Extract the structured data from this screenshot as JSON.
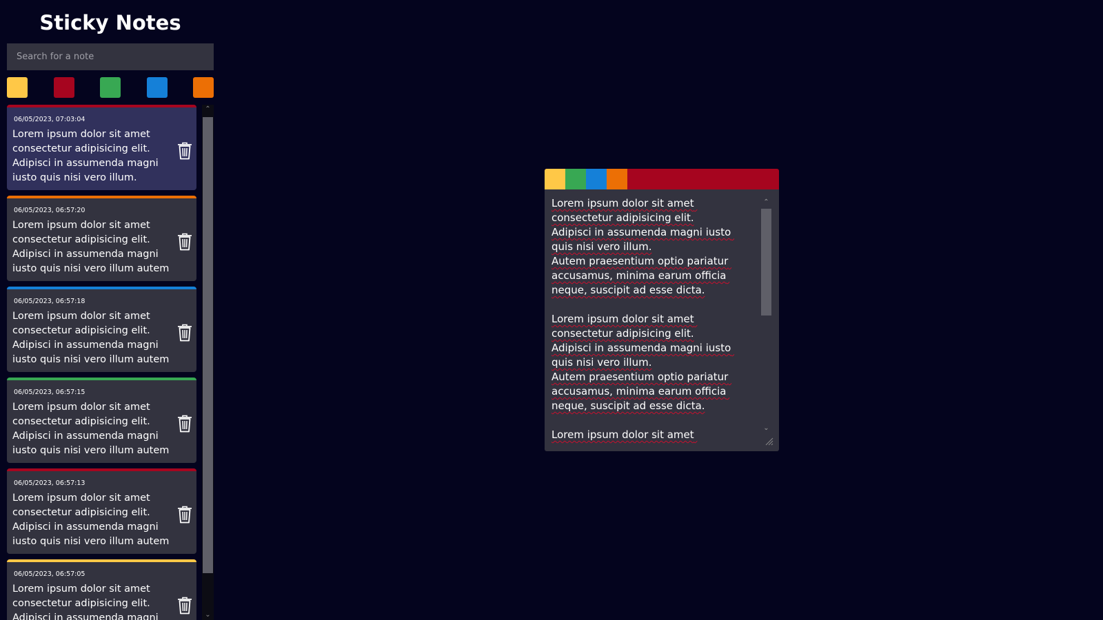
{
  "app": {
    "title": "Sticky Notes"
  },
  "search": {
    "placeholder": "Search for a note"
  },
  "colors": {
    "yellow": "#ffc847",
    "red": "#a6051f",
    "green": "#38a853",
    "blue": "#1580d8",
    "orange": "#ec6f05"
  },
  "palette": [
    "yellow",
    "red",
    "green",
    "blue",
    "orange"
  ],
  "notes": [
    {
      "date": "06/05/2023, 07:03:04",
      "color": "red",
      "active": true,
      "text": "Lorem ipsum dolor sit amet consectetur adipisicing elit. Adipisci in assumenda magni iusto quis nisi vero illum. Autem"
    },
    {
      "date": "06/05/2023, 06:57:20",
      "color": "orange",
      "active": false,
      "text": "Lorem ipsum dolor sit amet consectetur adipisicing elit. Adipisci in assumenda magni iusto quis nisi vero illum autem"
    },
    {
      "date": "06/05/2023, 06:57:18",
      "color": "blue",
      "active": false,
      "text": "Lorem ipsum dolor sit amet consectetur adipisicing elit. Adipisci in assumenda magni iusto quis nisi vero illum autem"
    },
    {
      "date": "06/05/2023, 06:57:15",
      "color": "green",
      "active": false,
      "text": "Lorem ipsum dolor sit amet consectetur adipisicing elit. Adipisci in assumenda magni iusto quis nisi vero illum autem"
    },
    {
      "date": "06/05/2023, 06:57:13",
      "color": "red",
      "active": false,
      "text": "Lorem ipsum dolor sit amet consectetur adipisicing elit. Adipisci in assumenda magni iusto quis nisi vero illum autem"
    },
    {
      "date": "06/05/2023, 06:57:05",
      "color": "yellow",
      "active": false,
      "text": "Lorem ipsum dolor sit amet consectetur adipisicing elit. Adipisci in assumenda magni iusto quis nisi vero illum autem"
    }
  ],
  "editor": {
    "bar_color": "red",
    "palette": [
      "yellow",
      "green",
      "blue",
      "orange"
    ],
    "text": "Lorem ipsum dolor sit amet consectetur adipisicing elit.\nAdipisci in assumenda magni iusto quis nisi vero illum.\nAutem praesentium optio pariatur accusamus, minima earum officia neque, suscipit ad esse dicta.\n\nLorem ipsum dolor sit amet consectetur adipisicing elit.\nAdipisci in assumenda magni iusto quis nisi vero illum.\nAutem praesentium optio pariatur accusamus, minima earum officia neque, suscipit ad esse dicta.\n\nLorem ipsum dolor sit amet consectetur adipisicing elit."
  },
  "icons": {
    "note_delete": "trash-icon",
    "scroll_up": "chevron-up-icon",
    "scroll_down": "chevron-down-icon",
    "resize": "resize-grip-icon"
  }
}
